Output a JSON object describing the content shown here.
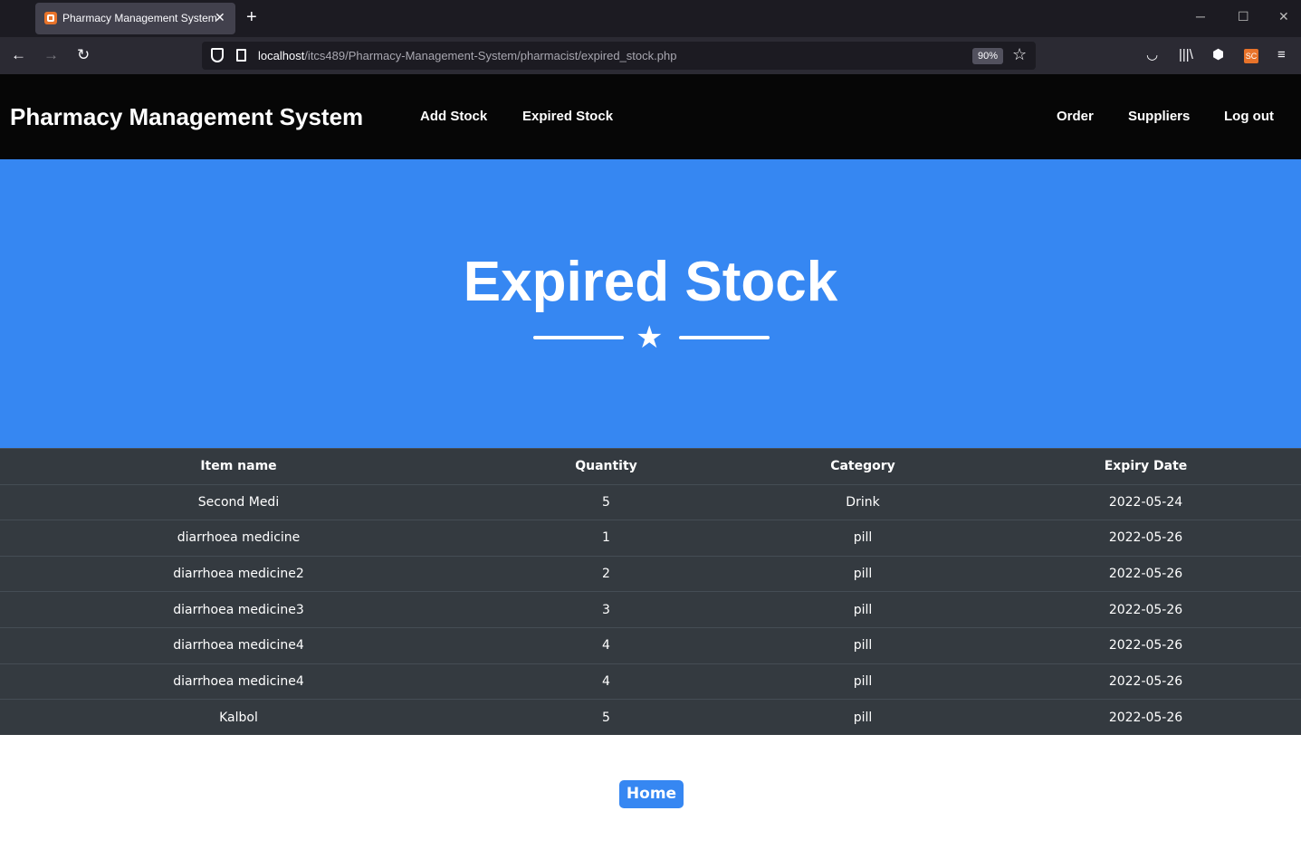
{
  "browser": {
    "tab_title": "Pharmacy Management System",
    "tab_close": "✕",
    "new_tab": "+",
    "url_host": "localhost",
    "url_path": "/itcs489/Pharmacy-Management-System/pharmacist/expired_stock.php",
    "zoom": "90%",
    "ext_label": "SC"
  },
  "header": {
    "brand": "Pharmacy Management System",
    "nav_left": [
      "Add Stock",
      "Expired Stock"
    ],
    "nav_right": [
      "Order",
      "Suppliers",
      "Log out"
    ]
  },
  "hero": {
    "title": "Expired Stock"
  },
  "table": {
    "columns": [
      "Item name",
      "Quantity",
      "Category",
      "Expiry Date"
    ],
    "rows": [
      [
        "Second Medi",
        "5",
        "Drink",
        "2022-05-24"
      ],
      [
        "diarrhoea medicine",
        "1",
        "pill",
        "2022-05-26"
      ],
      [
        "diarrhoea medicine2",
        "2",
        "pill",
        "2022-05-26"
      ],
      [
        "diarrhoea medicine3",
        "3",
        "pill",
        "2022-05-26"
      ],
      [
        "diarrhoea medicine4",
        "4",
        "pill",
        "2022-05-26"
      ],
      [
        "diarrhoea medicine4",
        "4",
        "pill",
        "2022-05-26"
      ],
      [
        "Kalbol",
        "5",
        "pill",
        "2022-05-26"
      ]
    ]
  },
  "home_button": "Home",
  "colors": {
    "accent": "#3687f2",
    "header_bg": "#060606",
    "table_bg": "#343a40"
  }
}
